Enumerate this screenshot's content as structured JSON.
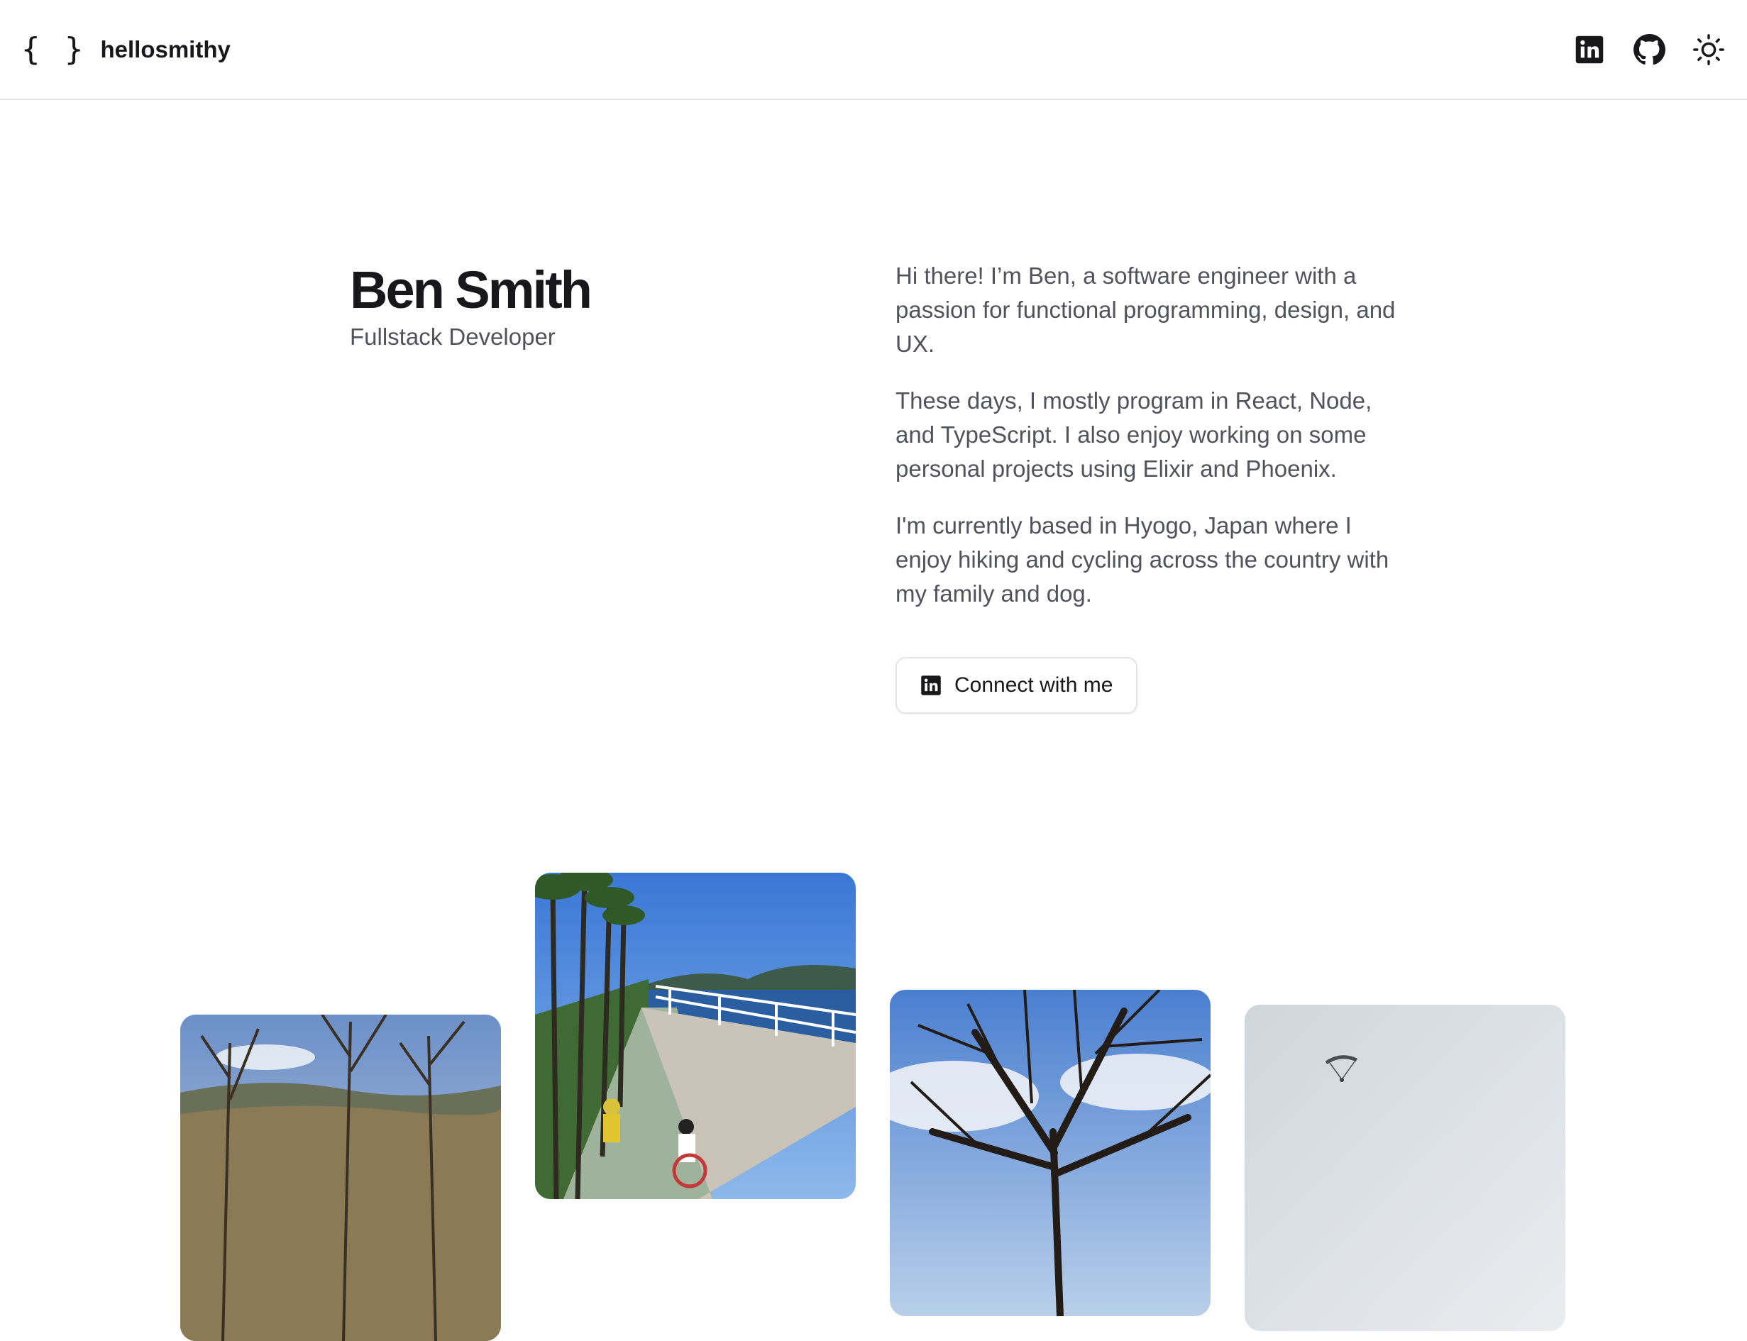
{
  "header": {
    "logo_icon": "{ }",
    "site_name": "hellosmithy",
    "icons": [
      "linkedin-icon",
      "github-icon",
      "sun-icon"
    ]
  },
  "hero": {
    "name": "Ben Smith",
    "role": "Fullstack Developer",
    "paragraphs": [
      "Hi there! I’m Ben, a software engineer with a passion for functional programming, design, and UX.",
      "These days, I mostly program in React, Node, and TypeScript. I also enjoy working on some personal projects using Elixir and Phoenix.",
      "I'm currently based in Hyogo, Japan where I enjoy hiking and cycling across the country with my family and dog."
    ],
    "connect_label": "Connect with me"
  },
  "photos": [
    {
      "subject": "bare trees on hillside"
    },
    {
      "subject": "cycling along seaside path"
    },
    {
      "subject": "bare tree branches against sky"
    },
    {
      "subject": "paraglider in hazy sky"
    }
  ],
  "colors": {
    "text": "#18181b",
    "muted": "#52525b",
    "border": "#e4e4e7"
  }
}
